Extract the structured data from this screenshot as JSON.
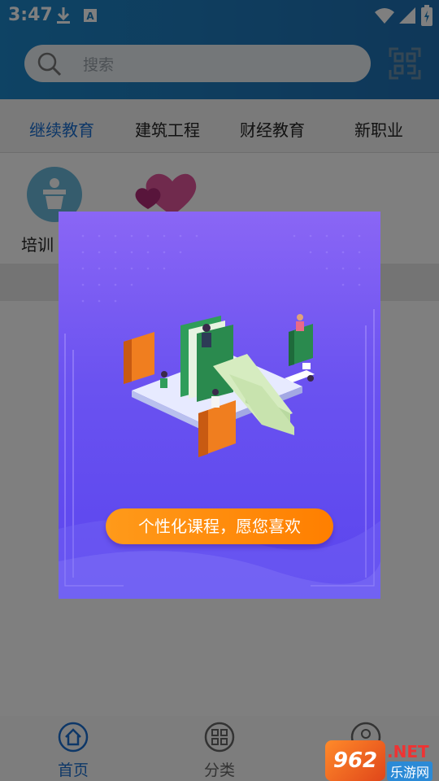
{
  "status_bar": {
    "time": "3:47"
  },
  "search": {
    "placeholder": "搜索"
  },
  "tabs": [
    {
      "label": "继续教育",
      "active": true
    },
    {
      "label": "建筑工程",
      "active": false
    },
    {
      "label": "财经教育",
      "active": false
    },
    {
      "label": "新职业",
      "active": false
    }
  ],
  "categories": [
    {
      "label": "培训"
    }
  ],
  "popup": {
    "button_label": "个性化课程，愿您喜欢"
  },
  "bottom_nav": [
    {
      "label": "首页",
      "icon": "home-icon",
      "active": true
    },
    {
      "label": "分类",
      "icon": "category-icon",
      "active": false
    }
  ],
  "watermark": {
    "logo": "962",
    "net": ".NET",
    "sub": "乐游网"
  },
  "colors": {
    "header": "#1f7fc0",
    "active_tab": "#1a6fd0",
    "popup_bg": "#6a52f0",
    "popup_button": "#ff8a0a"
  }
}
